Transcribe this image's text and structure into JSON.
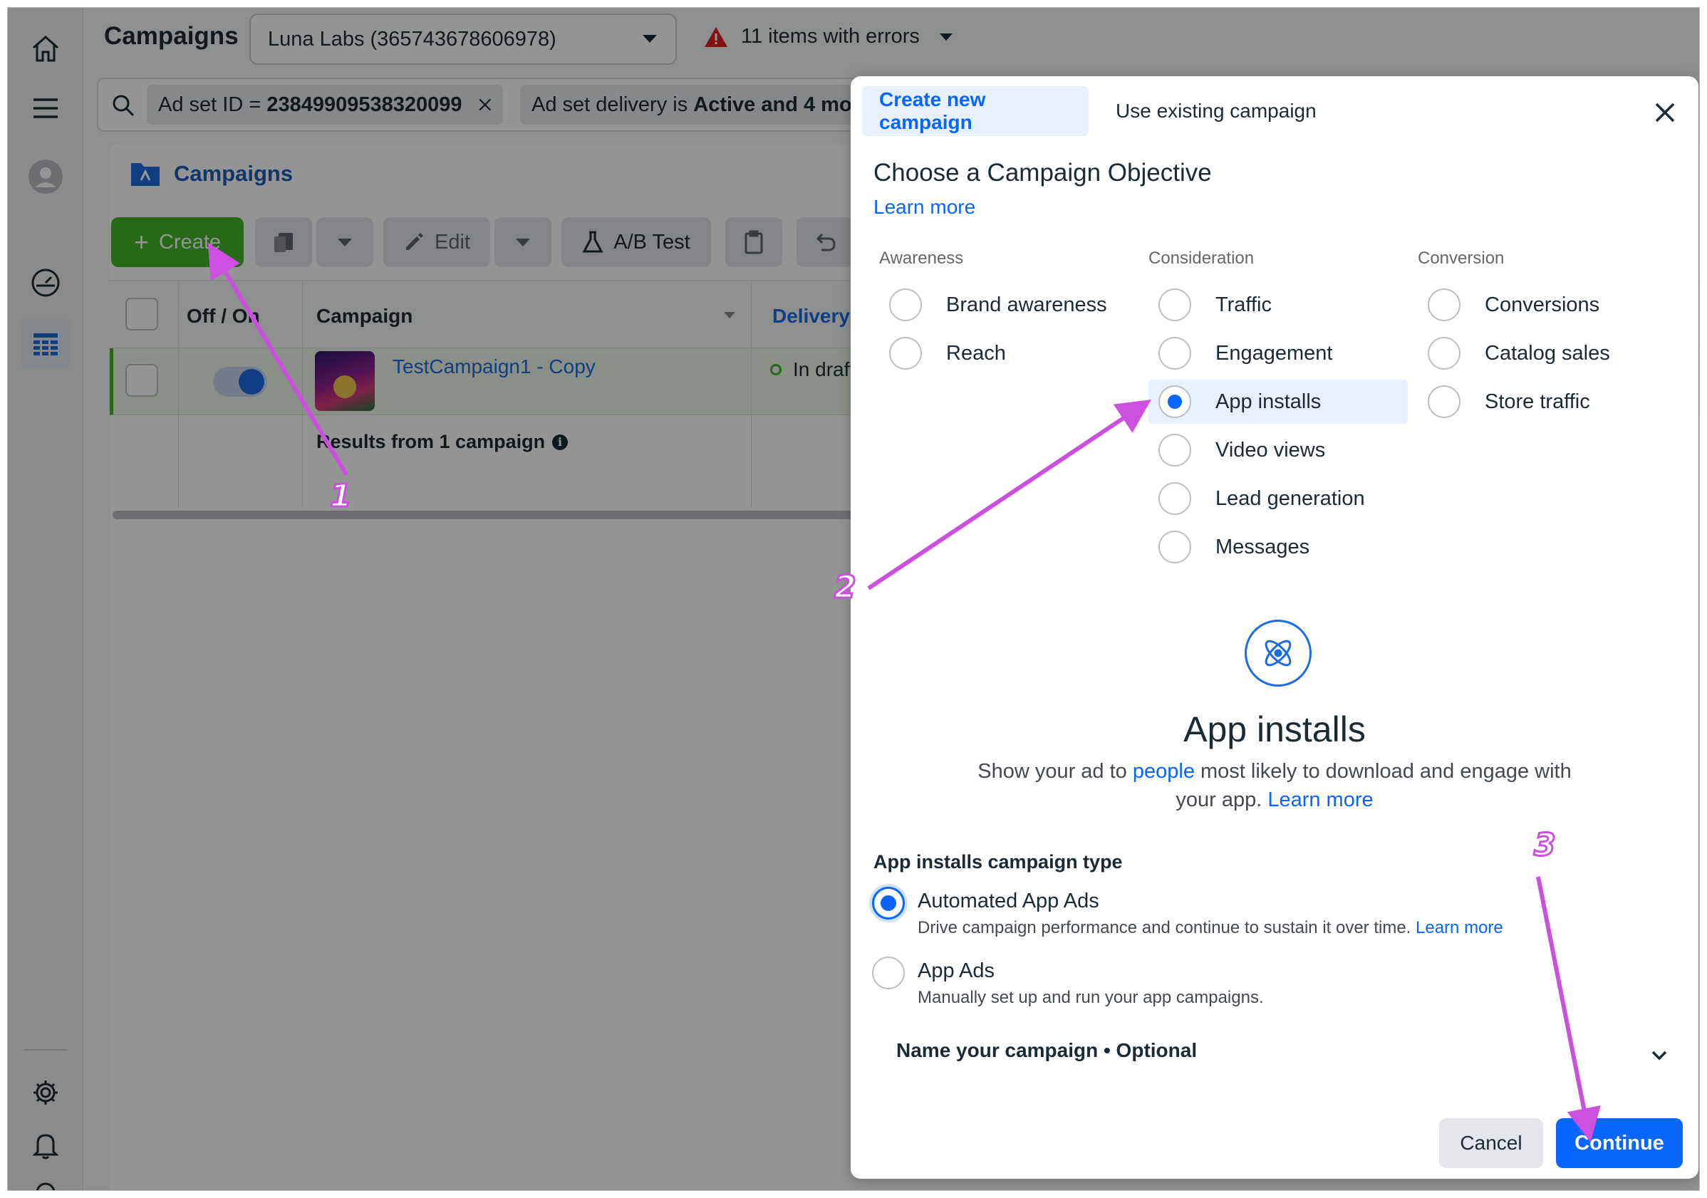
{
  "topbar": {
    "title": "Campaigns",
    "account": "Luna Labs (365743678606978)",
    "errors": "11 items with errors"
  },
  "filters": {
    "chip1_prefix": "Ad set ID = ",
    "chip1_value": "23849909538320099",
    "chip2_prefix": "Ad set delivery is ",
    "chip2_value": "Active and 4 more"
  },
  "content": {
    "section_title": "Campaigns",
    "toolbar": {
      "create": "Create",
      "edit": "Edit",
      "ab_test": "A/B Test"
    },
    "table": {
      "headers": {
        "offon": "Off / On",
        "campaign": "Campaign",
        "delivery": "Delivery ↑"
      },
      "row": {
        "name": "TestCampaign1 - Copy",
        "delivery": "In draft"
      },
      "results": "Results from 1 campaign"
    }
  },
  "modal": {
    "tab_new": "Create new campaign",
    "tab_existing": "Use existing campaign",
    "heading": "Choose a Campaign Objective",
    "learn_more": "Learn more",
    "columns": [
      {
        "title": "Awareness",
        "items": [
          "Brand awareness",
          "Reach"
        ]
      },
      {
        "title": "Consideration",
        "items": [
          "Traffic",
          "Engagement",
          "App installs",
          "Video views",
          "Lead generation",
          "Messages"
        ]
      },
      {
        "title": "Conversion",
        "items": [
          "Conversions",
          "Catalog sales",
          "Store traffic"
        ]
      }
    ],
    "selected_objective": "App installs",
    "detail": {
      "title": "App installs",
      "desc_a": "Show your ad to ",
      "desc_link": "people",
      "desc_b": " most likely to download and engage with your app. ",
      "desc_learn": "Learn more"
    },
    "type_heading": "App installs campaign type",
    "types": [
      {
        "label": "Automated App Ads",
        "sub": "Drive campaign performance and continue to sustain it over time. ",
        "sub_link": "Learn more",
        "selected": true
      },
      {
        "label": "App Ads",
        "sub": "Manually set up and run your app campaigns.",
        "selected": false
      }
    ],
    "name_row": "Name your campaign • Optional",
    "cancel": "Cancel",
    "continue": "Continue"
  },
  "annotations": {
    "step1": "1",
    "step2": "2",
    "step3": "3",
    "arrow_color": "#cc4fe0"
  }
}
